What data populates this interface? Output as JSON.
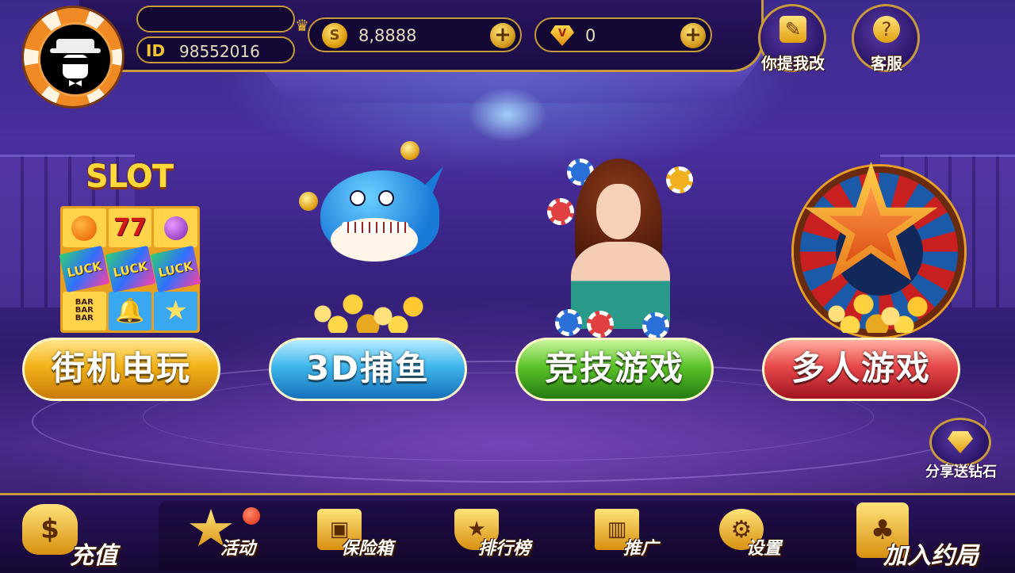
{
  "player": {
    "name": "",
    "id_label": "ID",
    "id_value": "98552016",
    "avatar_icon": "mafia-avatar-icon"
  },
  "currency": {
    "coins": {
      "value": "8,8888",
      "icon": "S"
    },
    "diamonds": {
      "value": "0",
      "icon": "V"
    },
    "plus_label": "+"
  },
  "top_buttons": {
    "feedback": {
      "label": "你提我改",
      "icon": "✎"
    },
    "service": {
      "label": "客服",
      "icon": "?"
    }
  },
  "games": [
    {
      "title": "街机电玩",
      "art_title": "SLOT",
      "color": "#f3b21a"
    },
    {
      "title": "3D捕鱼",
      "color": "#3fb6ec"
    },
    {
      "title": "竞技游戏",
      "color": "#5cc42a"
    },
    {
      "title": "多人游戏",
      "color": "#e8484a"
    }
  ],
  "slot_cells": [
    "",
    "77",
    "",
    "LUCK",
    "LUCK",
    "LUCK",
    "BAR\nBAR\nBAR",
    "🔔",
    "★"
  ],
  "share": {
    "label": "分享送钻石"
  },
  "bottom_nav": [
    {
      "label": "充值",
      "icon": "$"
    },
    {
      "label": "活动",
      "icon": "★",
      "has_notification": true
    },
    {
      "label": "保险箱",
      "icon": "▣"
    },
    {
      "label": "排行榜",
      "icon": "★"
    },
    {
      "label": "推广",
      "icon": "▥"
    },
    {
      "label": "设置",
      "icon": "⚙"
    },
    {
      "label": "加入约局",
      "icon": "♣"
    }
  ]
}
